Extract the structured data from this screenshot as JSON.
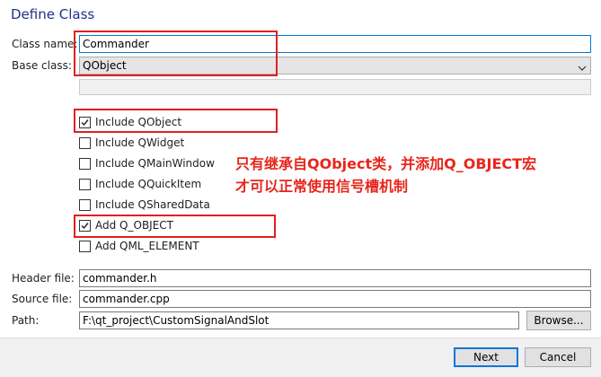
{
  "dialog": {
    "title": "Define Class"
  },
  "form": {
    "class_name_label": "Class name:",
    "class_name_value": "Commander",
    "base_class_label": "Base class:",
    "base_class_value": "QObject"
  },
  "options": [
    {
      "label": "Include QObject",
      "checked": true
    },
    {
      "label": "Include QWidget",
      "checked": false
    },
    {
      "label": "Include QMainWindow",
      "checked": false
    },
    {
      "label": "Include QQuickItem",
      "checked": false
    },
    {
      "label": "Include QSharedData",
      "checked": false
    },
    {
      "label": "Add Q_OBJECT",
      "checked": true
    },
    {
      "label": "Add QML_ELEMENT",
      "checked": false
    }
  ],
  "annotation": {
    "line1": "只有继承自QObject类，并添加Q_OBJECT宏",
    "line2": "才可以正常使用信号槽机制",
    "color": "#e8251b"
  },
  "files": {
    "header_label": "Header file:",
    "header_value": "commander.h",
    "source_label": "Source file:",
    "source_value": "commander.cpp",
    "path_label": "Path:",
    "path_value": "F:\\qt_project\\CustomSignalAndSlot",
    "browse_label": "Browse..."
  },
  "buttons": {
    "next": "Next",
    "cancel": "Cancel"
  },
  "icons": [
    "chevron-down-icon",
    "checkmark-icon"
  ],
  "colors": {
    "highlight_box": "#e0201f",
    "title": "#1e3287",
    "focus": "#0078d7"
  }
}
